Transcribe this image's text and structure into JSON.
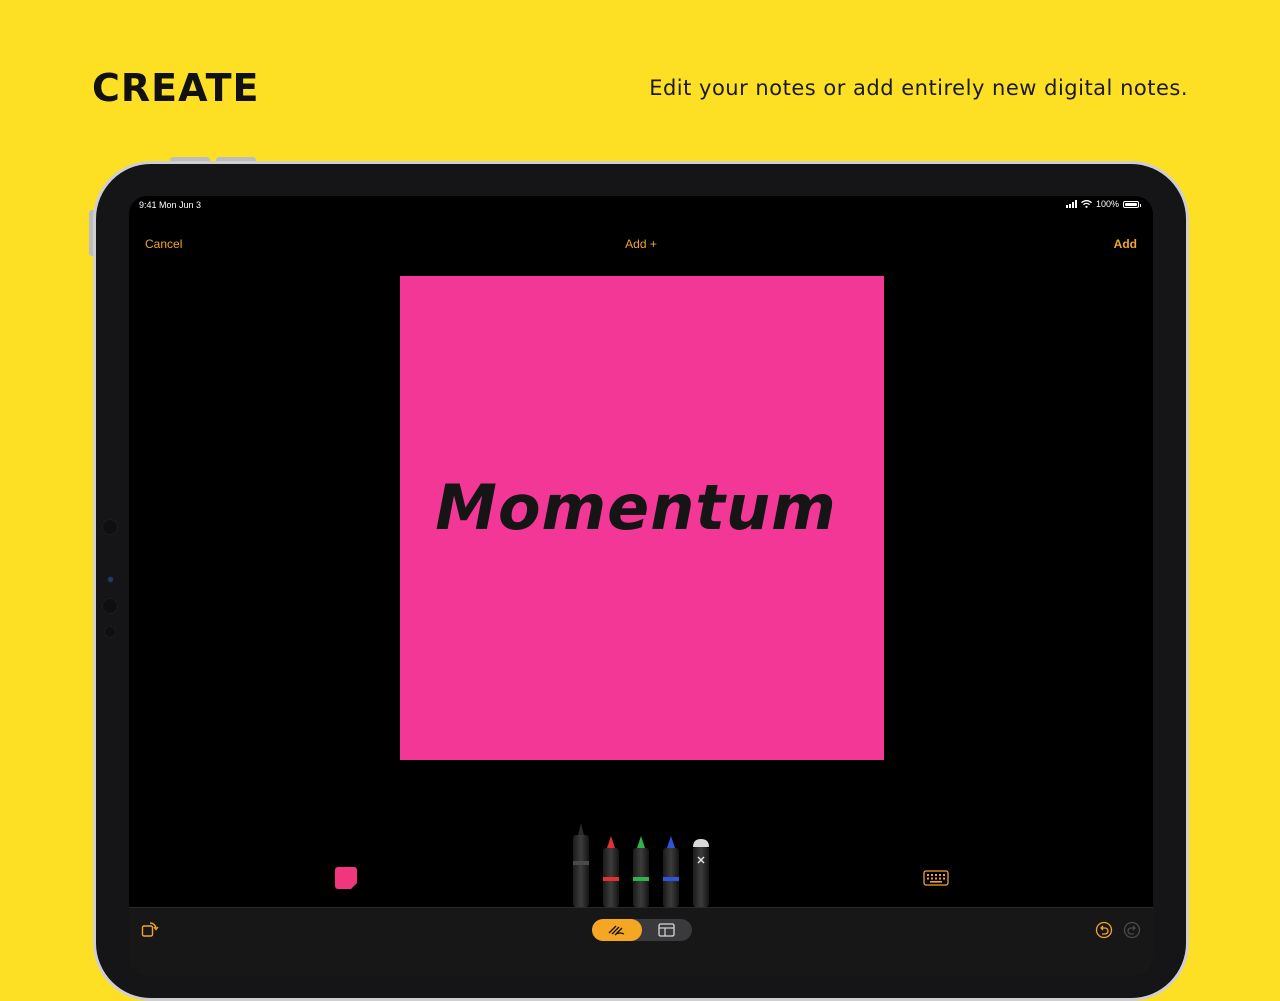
{
  "header": {
    "title": "CREATE",
    "tagline": "Edit your notes or add entirely new digital notes."
  },
  "status_bar": {
    "time": "9:41  Mon Jun 3",
    "battery": "100%"
  },
  "nav": {
    "cancel_label": "Cancel",
    "title": "Add +",
    "add_label": "Add"
  },
  "note": {
    "text": "Momentum",
    "color": "#F33796"
  },
  "tools": {
    "swatch_color": "#F0377E",
    "pens": [
      "black-marker",
      "red-marker",
      "green-marker",
      "blue-marker",
      "eraser"
    ]
  },
  "toolbar": {
    "modes": [
      "draw",
      "layout"
    ],
    "active_mode": "draw"
  },
  "colors": {
    "background": "#FDE024",
    "accent": "#F2A52A"
  }
}
